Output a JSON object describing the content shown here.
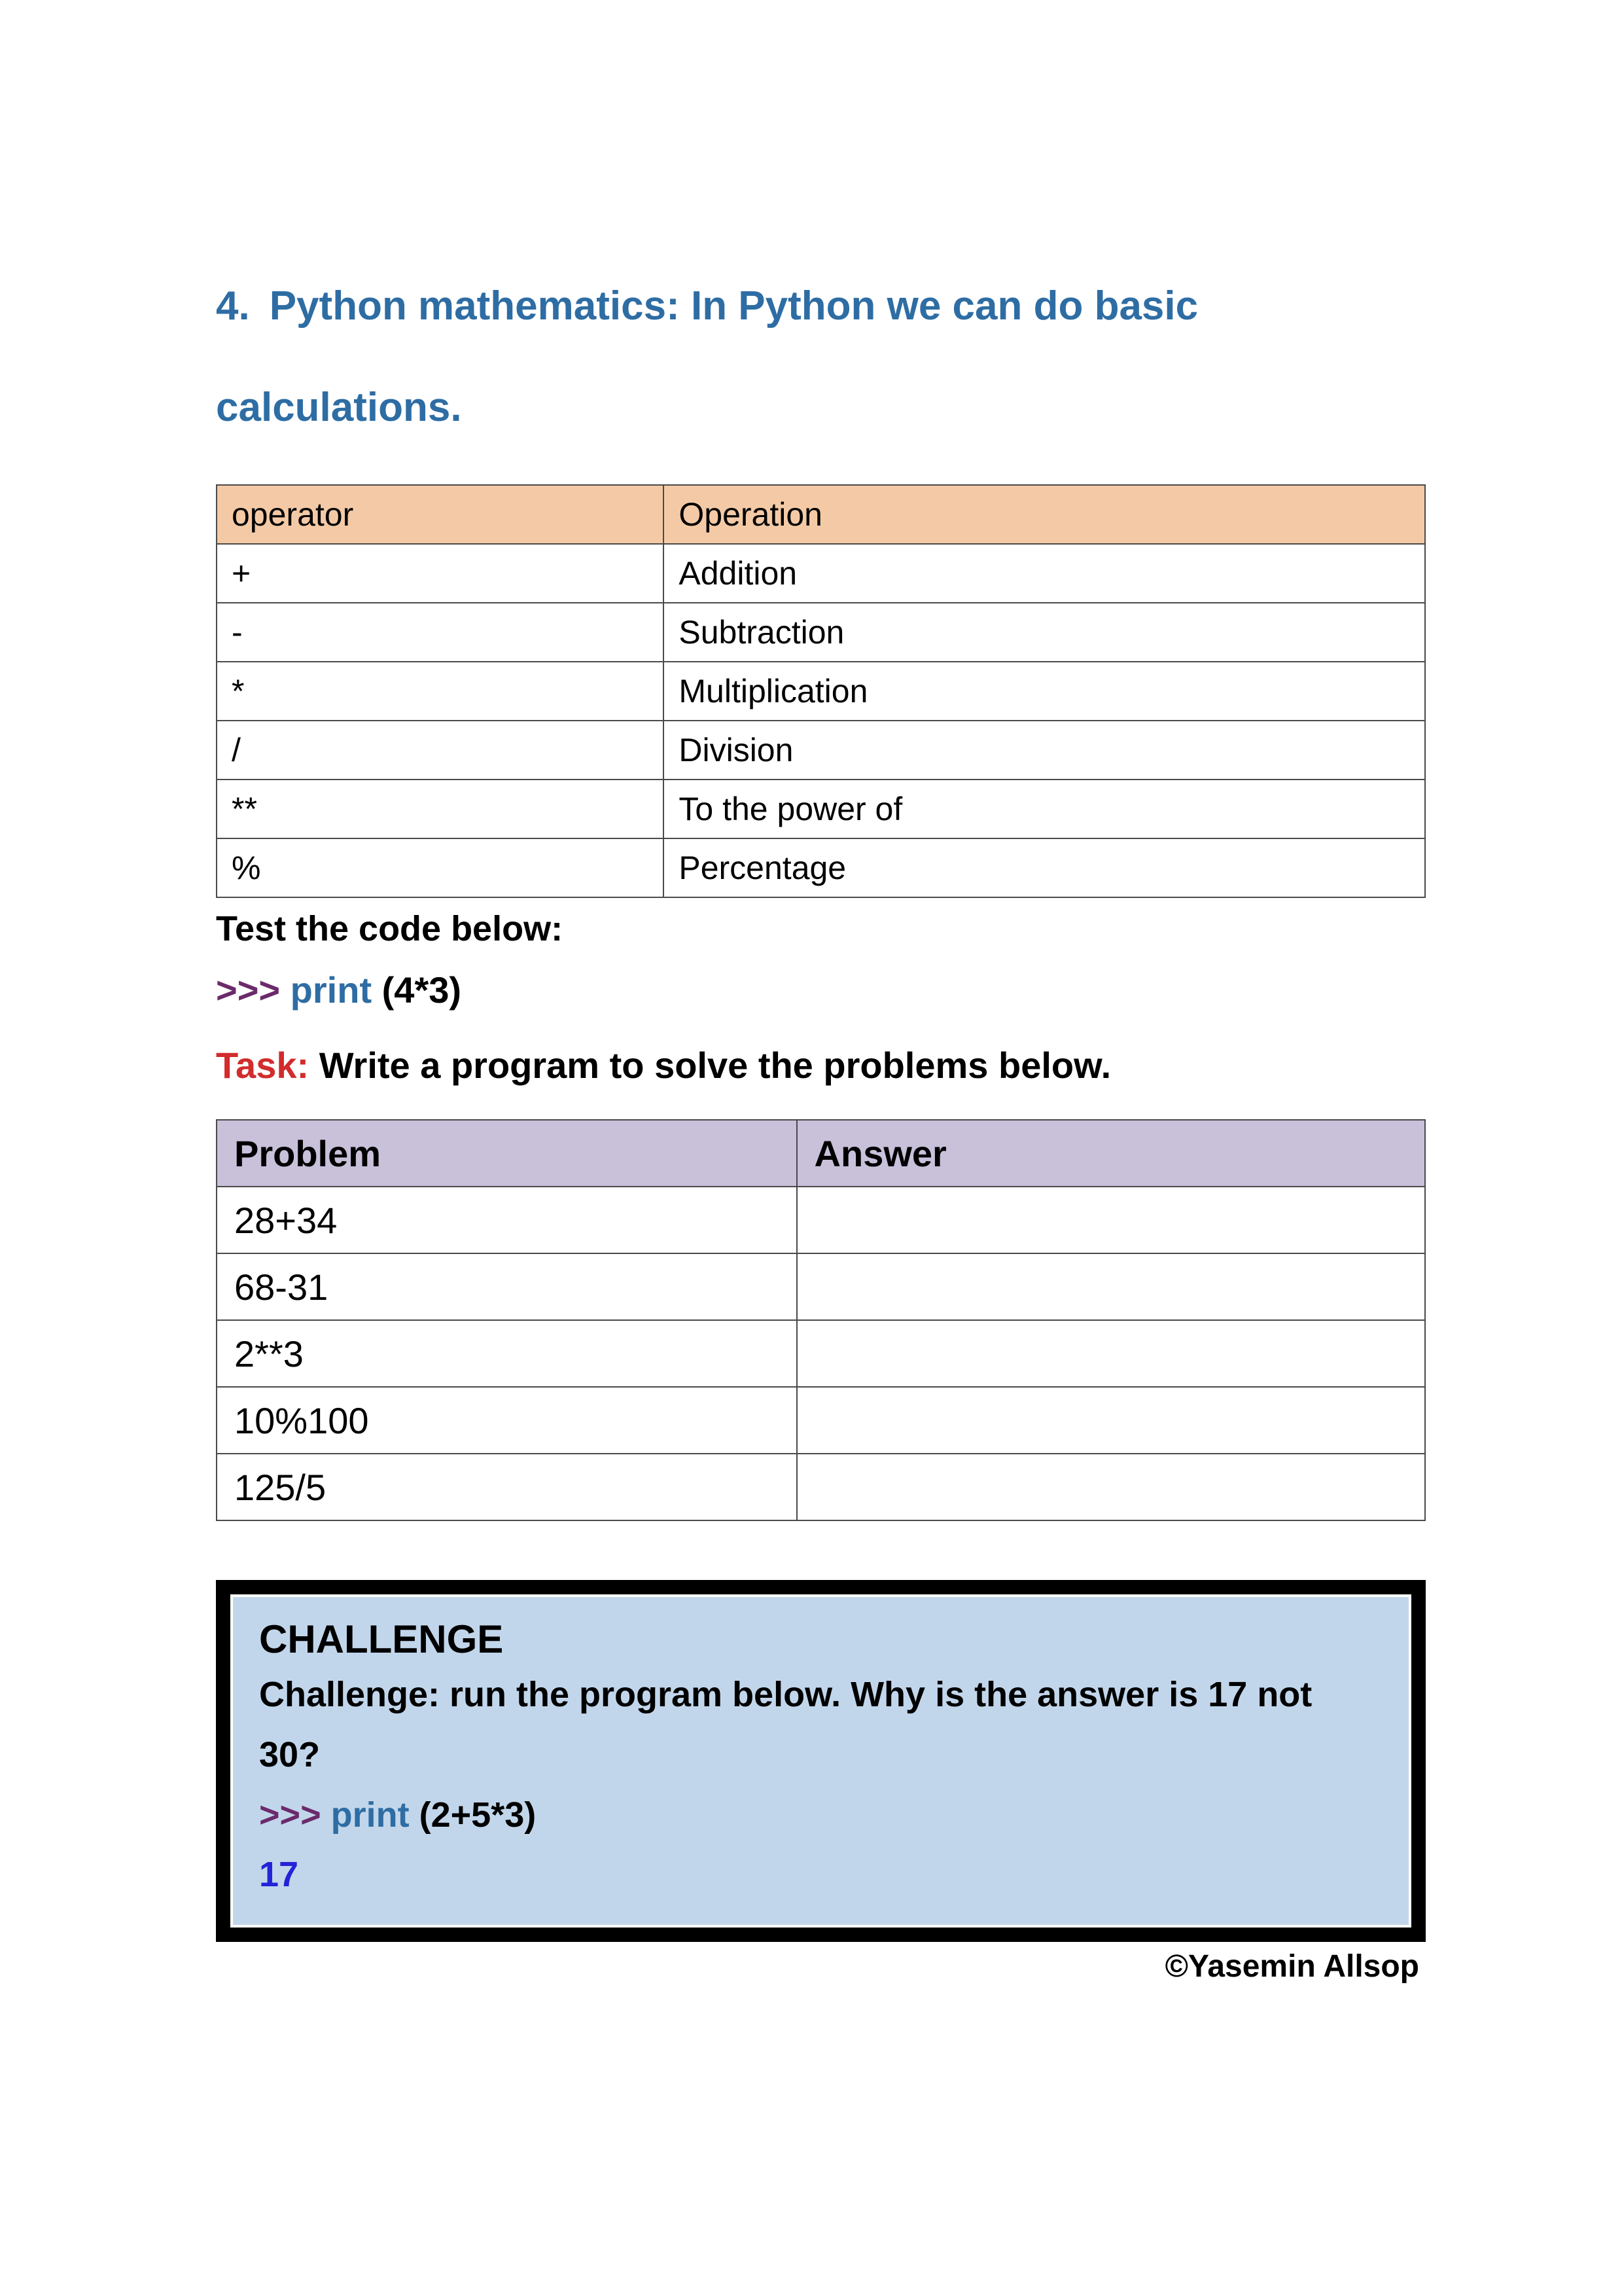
{
  "title": {
    "number": "4.",
    "text": "Python mathematics: In Python we can do basic calculations."
  },
  "ops_table": {
    "header": {
      "c1": "operator",
      "c2": "Operation"
    },
    "rows": [
      {
        "c1": "+",
        "c2": "Addition"
      },
      {
        "c1": "-",
        "c2": "Subtraction"
      },
      {
        "c1": "*",
        "c2": "Multiplication"
      },
      {
        "c1": "/",
        "c2": "Division"
      },
      {
        "c1": "**",
        "c2": "To the power of"
      },
      {
        "c1": "%",
        "c2": "Percentage"
      }
    ]
  },
  "test_label": "Test the code below:",
  "code_example": {
    "prompt": ">>>",
    "keyword": "print",
    "args": "(4*3)"
  },
  "task": {
    "label": "Task:",
    "text": "Write a program to solve the problems below."
  },
  "problems_table": {
    "header": {
      "c1": "Problem",
      "c2": "Answer"
    },
    "rows": [
      {
        "c1": "28+34",
        "c2": ""
      },
      {
        "c1": "68-31",
        "c2": ""
      },
      {
        "c1": "2**3",
        "c2": ""
      },
      {
        "c1": "10%100",
        "c2": ""
      },
      {
        "c1": "125/5",
        "c2": ""
      }
    ]
  },
  "challenge": {
    "heading": "CHALLENGE",
    "body": "Challenge: run the program below. Why is the answer is 17 not 30?",
    "code": {
      "prompt": ">>>",
      "keyword": "print",
      "args": "(2+5*3)"
    },
    "answer": "17"
  },
  "copyright": "©Yasemin Allsop"
}
